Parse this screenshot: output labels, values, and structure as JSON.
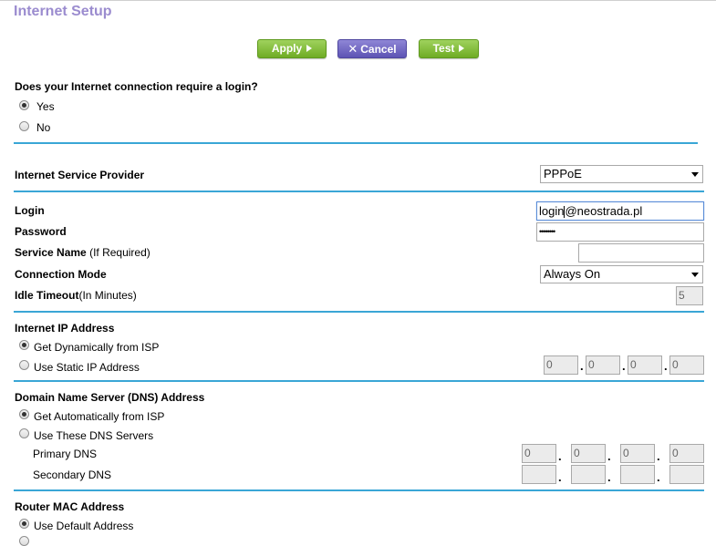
{
  "page": {
    "title": "Internet Setup"
  },
  "toolbar": {
    "apply_label": "Apply",
    "cancel_label": "Cancel",
    "test_label": "Test"
  },
  "login_question": {
    "text": "Does your Internet connection require a login?",
    "yes_label": "Yes",
    "no_label": "No",
    "selected": "Yes"
  },
  "isp": {
    "label": "Internet Service Provider",
    "value": "PPPoE"
  },
  "credentials": {
    "login_label": "Login",
    "login_value_before": "login",
    "login_value_after": "@neostrada.pl",
    "password_label": "Password",
    "password_value": "••••••••",
    "service_name_label": "Service Name",
    "service_name_hint": "(If Required)",
    "service_name_value": "",
    "connection_mode_label": "Connection Mode",
    "connection_mode_value": "Always On",
    "idle_timeout_label": "Idle Timeout",
    "idle_timeout_hint": "(In Minutes)",
    "idle_timeout_value": "5"
  },
  "ip_address": {
    "heading": "Internet IP Address",
    "dynamic_label": "Get Dynamically from ISP",
    "static_label": "Use Static IP Address",
    "selected": "dynamic",
    "octets": [
      "0",
      "0",
      "0",
      "0"
    ]
  },
  "dns": {
    "heading": "Domain Name Server (DNS) Address",
    "auto_label": "Get Automatically from ISP",
    "manual_label": "Use These DNS Servers",
    "selected": "auto",
    "primary_label": "Primary DNS",
    "primary_octets": [
      "0",
      "0",
      "0",
      "0"
    ],
    "secondary_label": "Secondary DNS",
    "secondary_octets": [
      "",
      "",
      "",
      ""
    ]
  },
  "mac": {
    "heading": "Router MAC Address",
    "default_label": "Use Default Address"
  },
  "colors": {
    "title": "#9b8ccf",
    "divider": "#3aa6d6",
    "button_green": "#7bbf2e",
    "button_purple": "#6a62c0"
  }
}
